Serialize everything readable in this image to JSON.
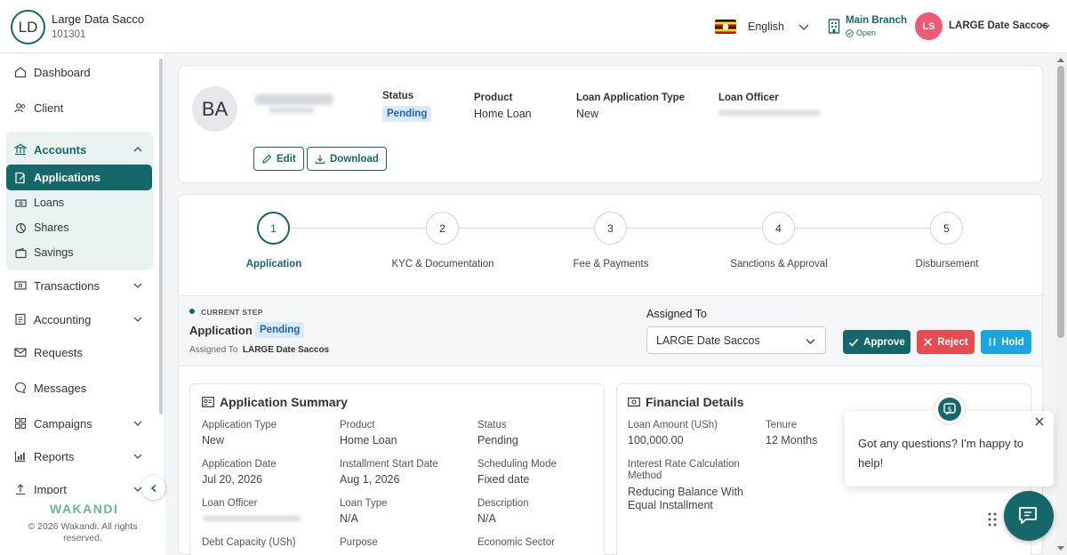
{
  "topbar": {
    "org_initials": "LD",
    "org_name": "Large Data Sacco",
    "org_code": "101301",
    "language": "English",
    "branch_name": "Main Branch",
    "branch_status": "Open",
    "user_initials": "LS",
    "user_name": "LARGE Date Saccos"
  },
  "sidebar": {
    "items": [
      {
        "label": "Dashboard",
        "icon": "home-icon"
      },
      {
        "label": "Client",
        "icon": "users-icon"
      },
      {
        "label": "Accounts",
        "icon": "bank-icon",
        "expanded": true
      },
      {
        "label": "Transactions",
        "icon": "cash-icon"
      },
      {
        "label": "Accounting",
        "icon": "ledger-icon"
      },
      {
        "label": "Requests",
        "icon": "mail-icon"
      },
      {
        "label": "Messages",
        "icon": "chat-icon"
      },
      {
        "label": "Campaigns",
        "icon": "grid-icon"
      },
      {
        "label": "Reports",
        "icon": "chart-icon"
      },
      {
        "label": "Import",
        "icon": "upload-icon"
      }
    ],
    "accounts_sub": [
      {
        "label": "Applications",
        "active": true
      },
      {
        "label": "Loans"
      },
      {
        "label": "Shares"
      },
      {
        "label": "Savings"
      }
    ],
    "brand": "WAKANDI",
    "copyright": "© 2026 Wakandi. All rights reserved."
  },
  "header": {
    "initials": "BA",
    "status_label": "Status",
    "status_value": "Pending",
    "product_label": "Product",
    "product_value": "Home Loan",
    "type_label": "Loan Application Type",
    "type_value": "New",
    "officer_label": "Loan Officer",
    "edit_label": "Edit",
    "download_label": "Download"
  },
  "steps": [
    {
      "num": "1",
      "label": "Application",
      "active": true
    },
    {
      "num": "2",
      "label": "KYC & Documentation"
    },
    {
      "num": "3",
      "label": "Fee & Payments"
    },
    {
      "num": "4",
      "label": "Sanctions & Approval"
    },
    {
      "num": "5",
      "label": "Disbursement"
    }
  ],
  "current_step": {
    "caption": "CURRENT STEP",
    "name": "Application",
    "status": "Pending",
    "assigned_prefix": "Assigned To",
    "assigned_name": "LARGE Date Saccos",
    "assigned_to_label": "Assigned To",
    "assigned_to_value": "LARGE Date Saccos",
    "approve_label": "Approve",
    "reject_label": "Reject",
    "hold_label": "Hold"
  },
  "summary": {
    "title": "Application Summary",
    "fields": [
      {
        "label": "Application Type",
        "value": "New"
      },
      {
        "label": "Product",
        "value": "Home Loan"
      },
      {
        "label": "Status",
        "value": "Pending"
      },
      {
        "label": "Application Date",
        "value": "Jul 20, 2026"
      },
      {
        "label": "Installment Start Date",
        "value": "Aug 1, 2026"
      },
      {
        "label": "Scheduling Mode",
        "value": "Fixed date"
      },
      {
        "label": "Loan Officer",
        "value": ""
      },
      {
        "label": "Loan Type",
        "value": "N/A"
      },
      {
        "label": "Description",
        "value": "N/A"
      },
      {
        "label": "Debt Capacity (USh)",
        "value": ""
      },
      {
        "label": "Purpose",
        "value": ""
      },
      {
        "label": "Economic Sector",
        "value": ""
      }
    ]
  },
  "financial": {
    "title": "Financial Details",
    "loan_amount_label": "Loan Amount (USh)",
    "loan_amount_value": "100,000.00",
    "tenure_label": "Tenure",
    "tenure_value": "12 Months",
    "interest_label": "Interest Rate Calculation Method",
    "interest_value": "Reducing Balance With Equal Installment"
  },
  "chat": {
    "message": "Got any questions? I'm happy to help!"
  },
  "colors": {
    "primary": "#16676a",
    "reject": "#e74a4f",
    "hold": "#1ba5e0",
    "pending_bg": "#dbe9f8",
    "avatar_user": "#ee5a73"
  }
}
